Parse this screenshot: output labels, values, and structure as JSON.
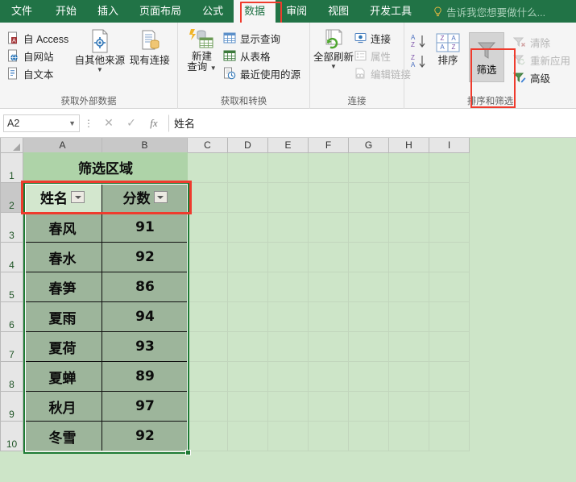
{
  "tabs": [
    {
      "label": "文件",
      "active": false
    },
    {
      "label": "开始",
      "active": false
    },
    {
      "label": "插入",
      "active": false
    },
    {
      "label": "页面布局",
      "active": false
    },
    {
      "label": "公式",
      "active": false
    },
    {
      "label": "数据",
      "active": true
    },
    {
      "label": "审阅",
      "active": false
    },
    {
      "label": "视图",
      "active": false
    },
    {
      "label": "开发工具",
      "active": false
    }
  ],
  "tellme": "告诉我您想要做什么...",
  "ribbon": {
    "groups": [
      {
        "title": "获取外部数据",
        "small": [
          "自 Access",
          "自网站",
          "自文本"
        ],
        "big": [
          "自其他来源",
          "现有连接"
        ]
      },
      {
        "title": "获取和转换",
        "big": [
          "新建",
          "查询"
        ],
        "small": [
          "显示查询",
          "从表格",
          "最近使用的源"
        ]
      },
      {
        "title": "连接",
        "big": [
          "全部刷新"
        ],
        "small": [
          "连接",
          "属性",
          "编辑链接"
        ]
      },
      {
        "title": "排序和筛选",
        "sort_label": "排序",
        "filter_label": "筛选",
        "small": [
          "清除",
          "重新应用",
          "高级"
        ]
      }
    ]
  },
  "formula_bar": {
    "name_box": "A2",
    "value": "姓名",
    "cancel_icon": "✕",
    "enter_icon": "✓",
    "fx_icon": "fx"
  },
  "grid": {
    "columns": [
      "A",
      "B",
      "C",
      "D",
      "E",
      "F",
      "G",
      "H",
      "I"
    ],
    "rows": [
      "1",
      "2",
      "3",
      "4",
      "5",
      "6",
      "7",
      "8",
      "9",
      "10"
    ],
    "selected_row": "2",
    "selected_range": "A2:B10"
  },
  "table": {
    "title": "筛选区域",
    "headers": [
      "姓名",
      "分数"
    ],
    "rows": [
      [
        "春风",
        "91"
      ],
      [
        "春水",
        "92"
      ],
      [
        "春笋",
        "86"
      ],
      [
        "夏雨",
        "94"
      ],
      [
        "夏荷",
        "93"
      ],
      [
        "夏蝉",
        "89"
      ],
      [
        "秋月",
        "97"
      ],
      [
        "冬雪",
        "92"
      ]
    ]
  },
  "colors": {
    "brand_green": "#217346",
    "annotation_red": "#ef3b2d",
    "sheet_bg": "#cde5c8",
    "table_fill": "#9db59b",
    "title_fill": "#aed3a8",
    "header_a_fill": "#d3e7ce"
  }
}
